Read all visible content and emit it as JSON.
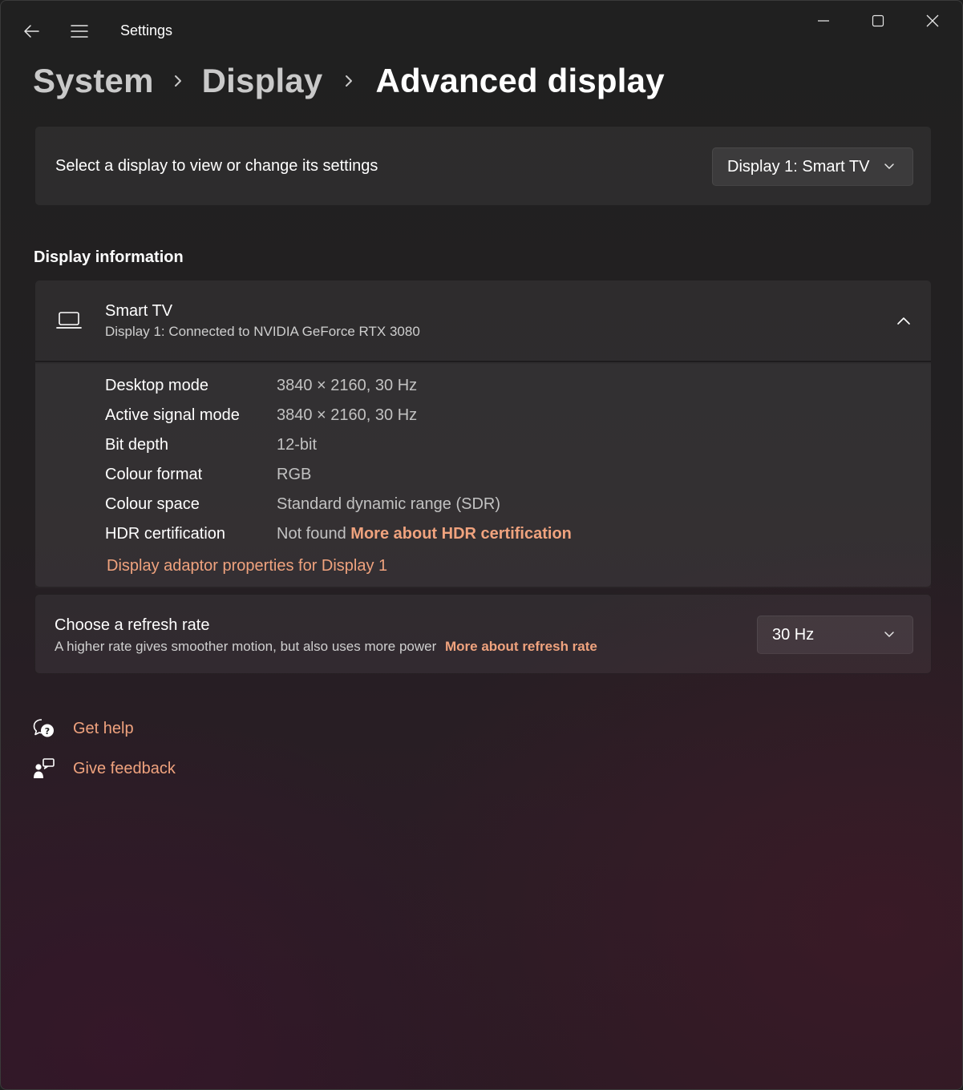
{
  "window": {
    "app_title": "Settings"
  },
  "breadcrumb": {
    "items": [
      "System",
      "Display",
      "Advanced display"
    ]
  },
  "display_select": {
    "label": "Select a display to view or change its settings",
    "selected": "Display 1: Smart TV"
  },
  "display_info": {
    "section_title": "Display information",
    "name": "Smart TV",
    "subtitle": "Display 1: Connected to NVIDIA GeForce RTX 3080",
    "rows": [
      {
        "key": "Desktop mode",
        "value": "3840 × 2160, 30 Hz"
      },
      {
        "key": "Active signal mode",
        "value": "3840 × 2160, 30 Hz"
      },
      {
        "key": "Bit depth",
        "value": "12-bit"
      },
      {
        "key": "Colour format",
        "value": "RGB"
      },
      {
        "key": "Colour space",
        "value": "Standard dynamic range (SDR)"
      },
      {
        "key": "HDR certification",
        "value": "Not found",
        "link": "More about HDR certification"
      }
    ],
    "adaptor_link": "Display adaptor properties for Display 1"
  },
  "refresh_rate": {
    "title": "Choose a refresh rate",
    "subtitle": "A higher rate gives smoother motion, but also uses more power",
    "link": "More about refresh rate",
    "selected": "30 Hz"
  },
  "help": {
    "get_help": "Get help",
    "give_feedback": "Give feedback"
  },
  "icons": {
    "back": "back-arrow-icon",
    "menu": "hamburger-menu-icon",
    "minimize": "minimize-icon",
    "maximize": "maximize-icon",
    "close": "close-icon",
    "display": "laptop-icon",
    "collapse": "chevron-up-icon",
    "dropdown": "chevron-down-icon",
    "help": "help-chat-icon",
    "feedback": "feedback-person-icon"
  },
  "colors": {
    "accent_link": "#f0a37e",
    "background": "#202020",
    "card": "#2b2b2b"
  }
}
